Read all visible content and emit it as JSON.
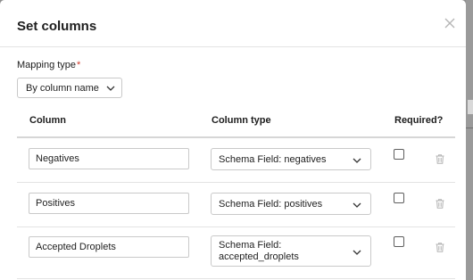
{
  "dialog": {
    "title": "Set columns",
    "close_icon": "close-icon"
  },
  "mapping": {
    "label": "Mapping type",
    "required_marker": "*",
    "selected": "By column name"
  },
  "table": {
    "headers": [
      "Column",
      "Column type",
      "Required?"
    ],
    "rows": [
      {
        "column": "Negatives",
        "type": "Schema Field: negatives",
        "type_line2": "",
        "required": false
      },
      {
        "column": "Positives",
        "type": "Schema Field: positives",
        "type_line2": "",
        "required": false
      },
      {
        "column": "Accepted Droplets",
        "type": "Schema Field:",
        "type_line2": "accepted_droplets",
        "required": false
      }
    ]
  },
  "icons": {
    "dropdown": "chevron-down-icon",
    "delete": "trash-icon"
  },
  "colors": {
    "required_star": "#d13a2b",
    "backdrop": "#8e8e8e"
  }
}
